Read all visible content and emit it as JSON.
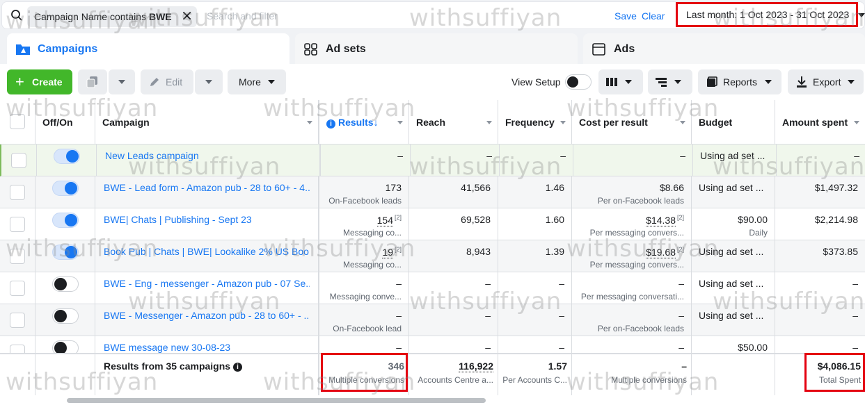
{
  "filter": {
    "chip_prefix": "Campaign Name contains ",
    "chip_value": "BWE",
    "placeholder": "Search and filter",
    "save": "Save",
    "clear": "Clear",
    "date_range": "Last month: 1 Oct 2023 - 31 Oct 2023"
  },
  "tabs": {
    "campaigns": "Campaigns",
    "adsets": "Ad sets",
    "ads": "Ads"
  },
  "toolbar": {
    "create": "Create",
    "edit": "Edit",
    "more": "More",
    "view_setup": "View Setup",
    "reports": "Reports",
    "export": "Export"
  },
  "columns": {
    "offon": "Off/On",
    "campaign": "Campaign",
    "results": "Results",
    "reach": "Reach",
    "frequency": "Frequency",
    "cost_per_result": "Cost per result",
    "budget": "Budget",
    "amount_spent": "Amount spent"
  },
  "rows": [
    {
      "on": true,
      "name": "New Leads campaign",
      "results": "–",
      "results_sub": "",
      "reach": "–",
      "frequency": "–",
      "cpr": "–",
      "cpr_sub": "",
      "budget": "Using ad set ...",
      "spent": "–"
    },
    {
      "on": true,
      "name": "BWE - Lead form - Amazon pub - 28 to 60+ - 4...",
      "results": "173",
      "results_sub": "On-Facebook leads",
      "reach": "41,566",
      "frequency": "1.46",
      "cpr": "$8.66",
      "cpr_sub": "Per on-Facebook leads",
      "budget": "Using ad set ...",
      "spent": "$1,497.32"
    },
    {
      "on": true,
      "name": "BWE| Chats | Publishing - Sept 23",
      "results": "154",
      "results_note": "[2]",
      "results_sub": "Messaging co...",
      "reach": "69,528",
      "frequency": "1.60",
      "cpr": "$14.38",
      "cpr_note": "[2]",
      "cpr_sub": "Per messaging convers...",
      "budget": "$90.00",
      "budget_sub": "Daily",
      "spent": "$2,214.98"
    },
    {
      "on": true,
      "name": "Book Pub | Chats | BWE| Lookalike 2% US Boo...",
      "results": "19",
      "results_note": "[2]",
      "results_sub": "Messaging co...",
      "reach": "8,943",
      "frequency": "1.39",
      "cpr": "$19.68",
      "cpr_note": "[2]",
      "cpr_sub": "Per messaging convers...",
      "budget": "Using ad set ...",
      "spent": "$373.85"
    },
    {
      "on": false,
      "name": "BWE - Eng - messenger - Amazon pub - 07 Se...",
      "results": "–",
      "results_sub": "Messaging conve...",
      "reach": "–",
      "frequency": "–",
      "cpr": "–",
      "cpr_sub": "Per messaging conversati...",
      "budget": "Using ad set ...",
      "spent": "–"
    },
    {
      "on": false,
      "name": "BWE - Messenger - Amazon pub - 28 to 60+ - ...",
      "results": "–",
      "results_sub": "On-Facebook lead",
      "reach": "–",
      "frequency": "–",
      "cpr": "–",
      "cpr_sub": "Per on-Facebook leads",
      "budget": "Using ad set ...",
      "spent": "–"
    },
    {
      "on": false,
      "name": "BWE message new 30-08-23",
      "results": "–",
      "results_sub": "",
      "reach": "–",
      "frequency": "–",
      "cpr": "–",
      "cpr_sub": "",
      "budget": "$50.00",
      "spent": "–"
    }
  ],
  "footer": {
    "label": "Results from 35 campaigns",
    "results": "346",
    "results_sub": "Multiple conversions",
    "reach": "116,922",
    "reach_sub": "Accounts Centre a...",
    "frequency": "1.57",
    "frequency_sub": "Per Accounts C...",
    "cpr": "–",
    "cpr_sub": "Multiple conversions",
    "spent": "$4,086.15",
    "spent_sub": "Total Spent"
  },
  "watermark": "withsuffiyan",
  "colors": {
    "accent": "#1877f2",
    "create": "#42b72a",
    "highlight": "#e4000f"
  }
}
